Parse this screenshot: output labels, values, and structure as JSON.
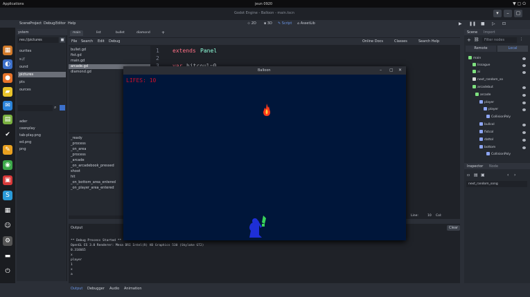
{
  "topbar": {
    "applications": "Applications",
    "clock": "jeun 0920",
    "icons": "▼ ▢ ⏻"
  },
  "titlebar": {
    "title": "Godot Engine - Balloon - main.tscn"
  },
  "menu": [
    "Scene",
    "Project",
    "Debug",
    "Editor",
    "Help"
  ],
  "workspaces": [
    "2D",
    "3D",
    "Script",
    "AssetLib"
  ],
  "filesystem": {
    "header": "ystem",
    "path": "res://pictures",
    "items": [
      "ourites",
      "s://",
      "ound",
      "pictures",
      "pts",
      "ources",
      "ader",
      "ceenplay",
      "tab-play.png",
      "ed.png",
      "png"
    ]
  },
  "editor_tabs": [
    "main",
    "list",
    "bullet",
    "diamond"
  ],
  "script_toolbar": {
    "file": "File",
    "search": "Search",
    "edit": "Edit",
    "debug": "Debug",
    "online_docs": "Online Docs",
    "classes": "Classes",
    "search_help": "Search Help"
  },
  "scripts": [
    "bullet.gd",
    "fist.gd",
    "main.gd",
    "arcade.gd",
    "diamond.gd"
  ],
  "functions": [
    "_ready",
    "_process",
    "_on_area",
    "_process",
    "_arcade",
    "_on_arcadebook_pressed",
    "shoot",
    "hit",
    "_on_bottom_area_entered",
    "_on_player_area_entered"
  ],
  "code": {
    "line1_num": "1",
    "line1_kw": "extends",
    "line1_type": "Panel",
    "line2_num": "2",
    "line3_num": "3",
    "line3_kw": "var",
    "line3_rest": "hitcoul=0"
  },
  "status": {
    "line": "Line:",
    "col": "10",
    "col2": "Col:"
  },
  "output": {
    "header": "Output",
    "clear": "Clear",
    "lines": [
      "** Debug Process Started **",
      "OpenGL ES 3.0 Renderer: Mesa DRI Intel(R) HD Graphics 530 (Skylake GT2)",
      "0.316665",
      "x",
      "player",
      "1",
      "x",
      "a"
    ]
  },
  "bottom_tabs": [
    "Output",
    "Debugger",
    "Audio",
    "Animation"
  ],
  "scene_panel": {
    "tabs": [
      "Scene",
      "Import"
    ],
    "filter": "Filter nodes",
    "remote": "Remote",
    "local": "Local",
    "nodes": [
      "main",
      "lissague",
      "ai",
      "next_random_so",
      "arcadebut",
      "arcade",
      "player",
      "player",
      "CollisionPoly",
      "bullcol",
      "fistcol",
      "dattol",
      "bottom",
      "CollisionPoly"
    ]
  },
  "inspector": {
    "tabs": [
      "Inspector",
      "Node"
    ],
    "selected": "next_random_song"
  },
  "game": {
    "title": "Balloon",
    "lifes": "LIFES: 10"
  },
  "colors": {
    "accent": "#6a96e8",
    "bg": "#2b2f37"
  }
}
